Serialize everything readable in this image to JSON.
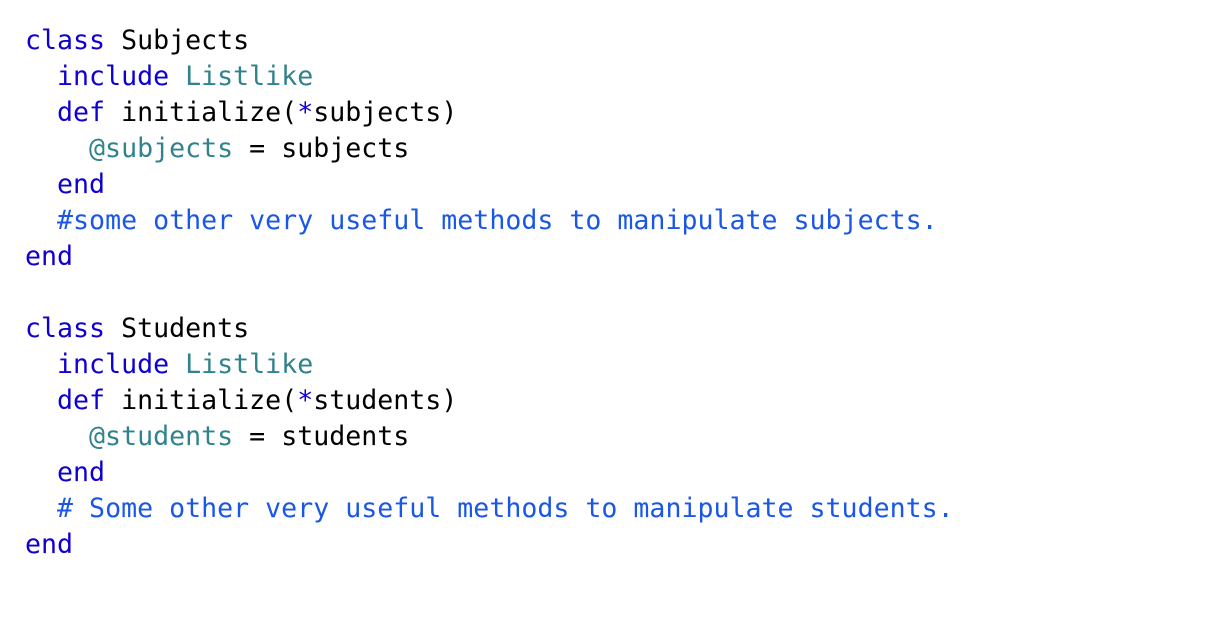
{
  "colors": {
    "keyword": "#0f00d0",
    "constant": "#30838c",
    "instance_variable": "#30838c",
    "comment": "#1a57e6",
    "plain": "#000000",
    "background": "#ffffff"
  },
  "code": {
    "lines": [
      [
        {
          "t": "keyword",
          "v": "class"
        },
        {
          "t": "plain",
          "v": " Subjects"
        }
      ],
      [
        {
          "t": "plain",
          "v": "  "
        },
        {
          "t": "keyword",
          "v": "include"
        },
        {
          "t": "plain",
          "v": " "
        },
        {
          "t": "const",
          "v": "Listlike"
        }
      ],
      [
        {
          "t": "plain",
          "v": "  "
        },
        {
          "t": "keyword",
          "v": "def"
        },
        {
          "t": "plain",
          "v": " initialize("
        },
        {
          "t": "keyword",
          "v": "*"
        },
        {
          "t": "plain",
          "v": "subjects)"
        }
      ],
      [
        {
          "t": "plain",
          "v": "    "
        },
        {
          "t": "ivar",
          "v": "@subjects"
        },
        {
          "t": "plain",
          "v": " = subjects"
        }
      ],
      [
        {
          "t": "plain",
          "v": "  "
        },
        {
          "t": "keyword",
          "v": "end"
        }
      ],
      [
        {
          "t": "plain",
          "v": "  "
        },
        {
          "t": "comment",
          "v": "#some other very useful methods to manipulate subjects."
        }
      ],
      [
        {
          "t": "keyword",
          "v": "end"
        }
      ],
      [],
      [
        {
          "t": "keyword",
          "v": "class"
        },
        {
          "t": "plain",
          "v": " Students"
        }
      ],
      [
        {
          "t": "plain",
          "v": "  "
        },
        {
          "t": "keyword",
          "v": "include"
        },
        {
          "t": "plain",
          "v": " "
        },
        {
          "t": "const",
          "v": "Listlike"
        }
      ],
      [
        {
          "t": "plain",
          "v": "  "
        },
        {
          "t": "keyword",
          "v": "def"
        },
        {
          "t": "plain",
          "v": " initialize("
        },
        {
          "t": "keyword",
          "v": "*"
        },
        {
          "t": "plain",
          "v": "students)"
        }
      ],
      [
        {
          "t": "plain",
          "v": "    "
        },
        {
          "t": "ivar",
          "v": "@students"
        },
        {
          "t": "plain",
          "v": " = students"
        }
      ],
      [
        {
          "t": "plain",
          "v": "  "
        },
        {
          "t": "keyword",
          "v": "end"
        }
      ],
      [
        {
          "t": "plain",
          "v": "  "
        },
        {
          "t": "comment",
          "v": "# Some other very useful methods to manipulate students."
        }
      ],
      [
        {
          "t": "keyword",
          "v": "end"
        }
      ]
    ]
  }
}
